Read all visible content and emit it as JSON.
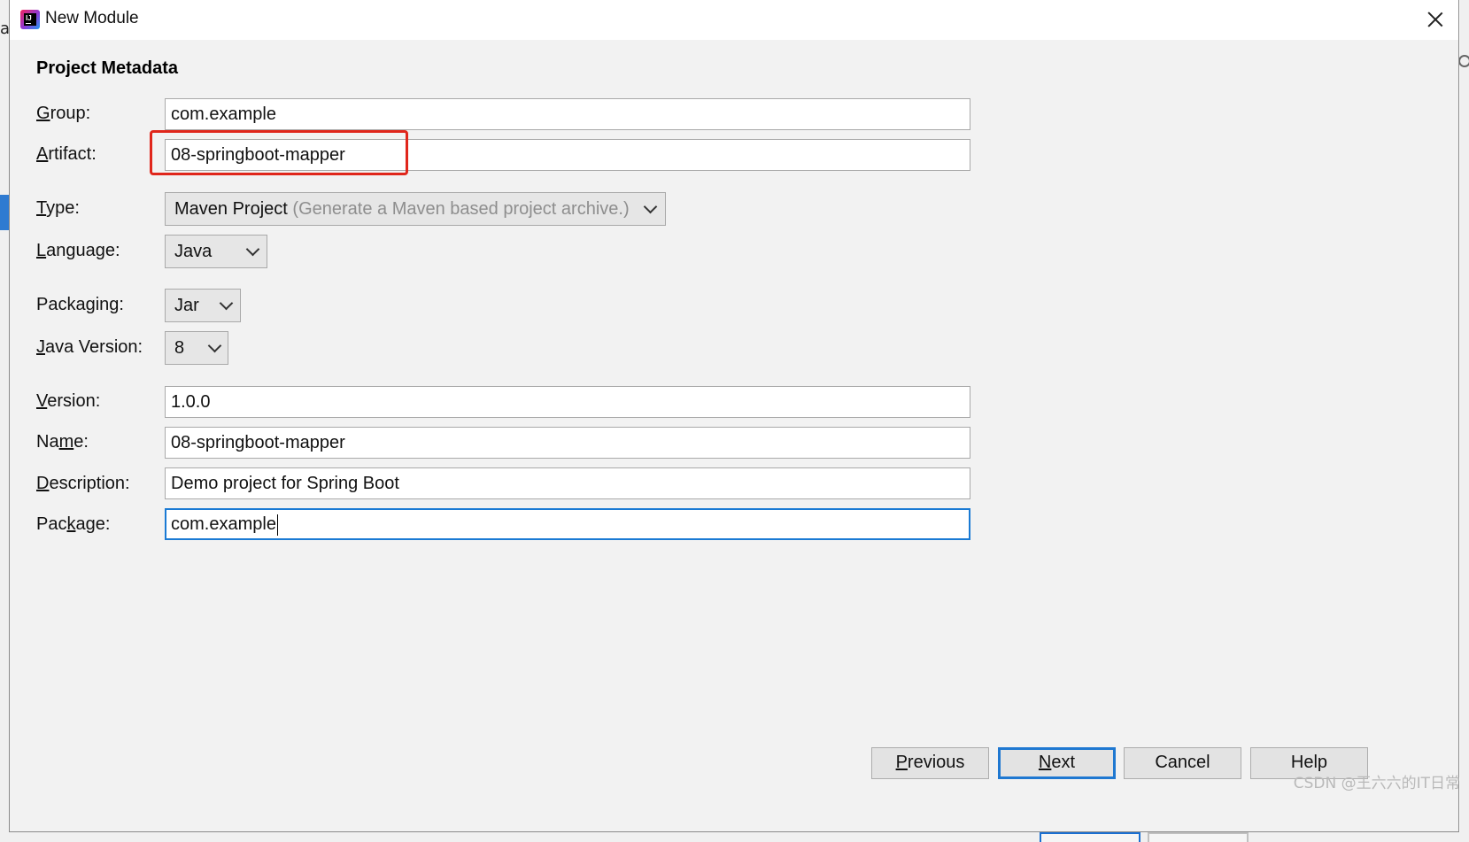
{
  "window": {
    "title": "New Module",
    "close_glyph": ""
  },
  "section": {
    "title": "Project Metadata"
  },
  "form": {
    "group": {
      "label_u": "G",
      "label_rest": "roup:",
      "value": "com.example"
    },
    "artifact": {
      "label_pre": "",
      "label_u": "A",
      "label_rest": "rtifact:",
      "value": "08-springboot-mapper"
    },
    "type": {
      "label_u": "T",
      "label_rest": "ype:",
      "value": "Maven Project",
      "hint": "(Generate a Maven based project archive.)"
    },
    "language": {
      "label_u": "L",
      "label_rest": "anguage:",
      "value": "Java"
    },
    "packaging": {
      "label_pre": "Packa",
      "label_u": "g",
      "label_rest": "ing:",
      "value": "Jar"
    },
    "java_version": {
      "label_u": "J",
      "label_rest": "ava Version:",
      "value": "8"
    },
    "version": {
      "label_u": "V",
      "label_rest": "ersion:",
      "value": "1.0.0"
    },
    "name": {
      "label_pre": "Na",
      "label_u": "m",
      "label_rest": "e:",
      "value": "08-springboot-mapper"
    },
    "description": {
      "label_u": "D",
      "label_rest": "escription:",
      "value": "Demo project for Spring Boot"
    },
    "package": {
      "label_pre": "Pac",
      "label_u": "k",
      "label_rest": "age:",
      "value": "com.example"
    }
  },
  "buttons": {
    "previous": {
      "u": "P",
      "rest": "revious"
    },
    "next": {
      "u": "N",
      "rest": "ext"
    },
    "cancel": "Cancel",
    "help": "Help"
  },
  "background": {
    "left_letter": "a"
  },
  "watermark": "CSDN @王六六的IT日常",
  "colors": {
    "highlight": "#e0261b",
    "focus": "#1a7ad4"
  }
}
